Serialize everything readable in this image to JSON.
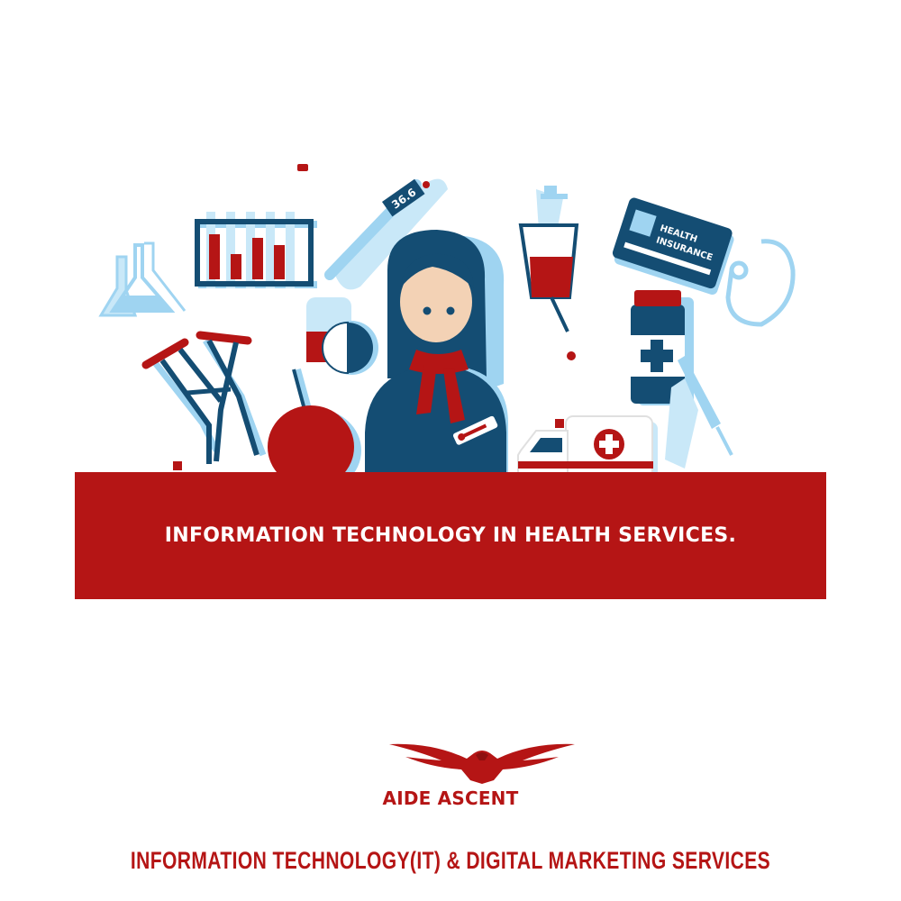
{
  "illustration": {
    "thermometer_reading": "36.6",
    "insurance_card_text_line1": "HEALTH",
    "insurance_card_text_line2": "INSURANCE"
  },
  "banner": {
    "text": "INFORMATION TECHNOLOGY IN HEALTH SERVICES."
  },
  "brand": {
    "name": "AIDE ASCENT",
    "tagline": "INFORMATION TECHNOLOGY(IT) & DIGITAL MARKETING SERVICES"
  },
  "colors": {
    "brand_red": "#b51515",
    "navy": "#144d73",
    "light_blue": "#9fd4f1",
    "skin": "#f3d2b5"
  },
  "icons": [
    "test-tubes-icon",
    "flask-icon",
    "thermometer-icon",
    "syringe-icon",
    "insurance-card-icon",
    "stethoscope-icon",
    "crutches-icon",
    "enema-bulb-icon",
    "pill-capsule-icon",
    "medicine-bottle-icon",
    "ambulance-icon",
    "doctor-icon",
    "eagle-logo-icon"
  ]
}
